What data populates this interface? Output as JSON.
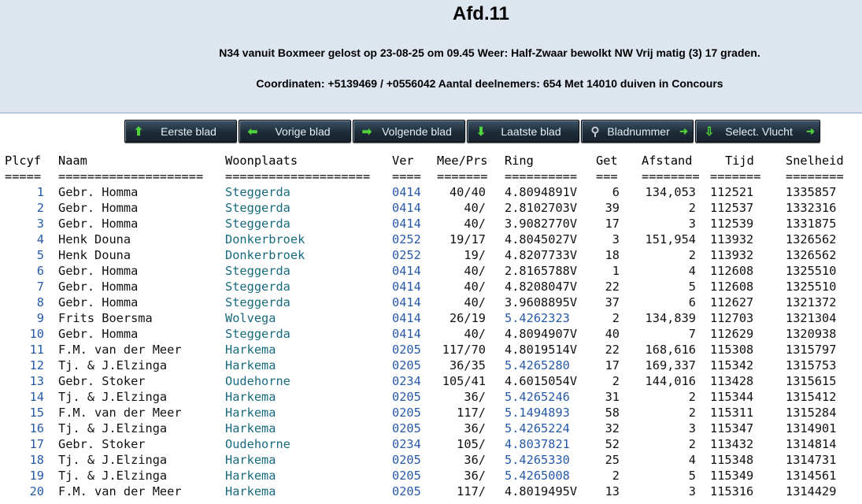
{
  "header": {
    "title": "Afd.11",
    "line1": "N34 vanuit Boxmeer gelost op 23-08-25 om 09.45 Weer: Half-Zwaar bewolkt NW Vrij matig (3) 17 graden.",
    "line2": "Coordinaten: +5139469 / +0556042 Aantal deelnemers: 654 Met 14010 duiven in Concours"
  },
  "nav": {
    "first": "Eerste blad",
    "prev": "Vorige blad",
    "next": "Volgende blad",
    "last": "Laatste blad",
    "page": "Bladnummer",
    "select": "Select. Vlucht"
  },
  "columns": {
    "pl": "Plcyf",
    "naam": "Naam",
    "woon": "Woonplaats",
    "ver": "Ver",
    "mee": "Mee/Prs",
    "ring": "Ring",
    "get": "Get",
    "afs": "Afstand",
    "tijd": "Tijd",
    "snel": "Snelheid"
  },
  "separators": {
    "pl": "=====",
    "naam": "====================",
    "woon": "====================",
    "ver": "====",
    "mee": "=======",
    "ring": "==========",
    "get": "===",
    "afs": "========",
    "tijd": "=======",
    "snel": "========"
  },
  "rows": [
    {
      "pl": "1",
      "naam": "Gebr. Homma",
      "woon": "Steggerda",
      "ver": "0414",
      "mee": "40/40",
      "ring": "4.8094891V",
      "get": "6",
      "afs": "134,053",
      "tijd": "112521",
      "snel": "1335857"
    },
    {
      "pl": "2",
      "naam": "Gebr. Homma",
      "woon": "Steggerda",
      "ver": "0414",
      "mee": "40/",
      "ring": "2.8102703V",
      "get": "39",
      "afs": "2",
      "tijd": "112537",
      "snel": "1332316"
    },
    {
      "pl": "3",
      "naam": "Gebr. Homma",
      "woon": "Steggerda",
      "ver": "0414",
      "mee": "40/",
      "ring": "3.9082770V",
      "get": "17",
      "afs": "3",
      "tijd": "112539",
      "snel": "1331875"
    },
    {
      "pl": "4",
      "naam": "Henk Douna",
      "woon": "Donkerbroek",
      "ver": "0252",
      "mee": "19/17",
      "ring": "4.8045027V",
      "get": "3",
      "afs": "151,954",
      "tijd": "113932",
      "snel": "1326562"
    },
    {
      "pl": "5",
      "naam": "Henk Douna",
      "woon": "Donkerbroek",
      "ver": "0252",
      "mee": "19/",
      "ring": "4.8207733V",
      "get": "18",
      "afs": "2",
      "tijd": "113932",
      "snel": "1326562"
    },
    {
      "pl": "6",
      "naam": "Gebr. Homma",
      "woon": "Steggerda",
      "ver": "0414",
      "mee": "40/",
      "ring": "2.8165788V",
      "get": "1",
      "afs": "4",
      "tijd": "112608",
      "snel": "1325510"
    },
    {
      "pl": "7",
      "naam": "Gebr. Homma",
      "woon": "Steggerda",
      "ver": "0414",
      "mee": "40/",
      "ring": "4.8208047V",
      "get": "22",
      "afs": "5",
      "tijd": "112608",
      "snel": "1325510"
    },
    {
      "pl": "8",
      "naam": "Gebr. Homma",
      "woon": "Steggerda",
      "ver": "0414",
      "mee": "40/",
      "ring": "3.9608895V",
      "get": "37",
      "afs": "6",
      "tijd": "112627",
      "snel": "1321372"
    },
    {
      "pl": "9",
      "naam": "Frits Boersma",
      "woon": "Wolvega",
      "ver": "0414",
      "mee": "26/19",
      "ring": "5.4262323",
      "get": "2",
      "afs": "134,839",
      "tijd": "112703",
      "snel": "1321304"
    },
    {
      "pl": "10",
      "naam": "Gebr. Homma",
      "woon": "Steggerda",
      "ver": "0414",
      "mee": "40/",
      "ring": "4.8094907V",
      "get": "40",
      "afs": "7",
      "tijd": "112629",
      "snel": "1320938"
    },
    {
      "pl": "11",
      "naam": "F.M. van der Meer",
      "woon": "Harkema",
      "ver": "0205",
      "mee": "117/70",
      "ring": "4.8019514V",
      "get": "22",
      "afs": "168,616",
      "tijd": "115308",
      "snel": "1315797"
    },
    {
      "pl": "12",
      "naam": "Tj. & J.Elzinga",
      "woon": "Harkema",
      "ver": "0205",
      "mee": "36/35",
      "ring": "5.4265280",
      "get": "17",
      "afs": "169,337",
      "tijd": "115342",
      "snel": "1315753"
    },
    {
      "pl": "13",
      "naam": "Gebr. Stoker",
      "woon": "Oudehorne",
      "ver": "0234",
      "mee": "105/41",
      "ring": "4.6015054V",
      "get": "2",
      "afs": "144,016",
      "tijd": "113428",
      "snel": "1315615"
    },
    {
      "pl": "14",
      "naam": "Tj. & J.Elzinga",
      "woon": "Harkema",
      "ver": "0205",
      "mee": "36/",
      "ring": "5.4265246",
      "get": "31",
      "afs": "2",
      "tijd": "115344",
      "snel": "1315412"
    },
    {
      "pl": "15",
      "naam": "F.M. van der Meer",
      "woon": "Harkema",
      "ver": "0205",
      "mee": "117/",
      "ring": "5.1494893",
      "get": "58",
      "afs": "2",
      "tijd": "115311",
      "snel": "1315284"
    },
    {
      "pl": "16",
      "naam": "Tj. & J.Elzinga",
      "woon": "Harkema",
      "ver": "0205",
      "mee": "36/",
      "ring": "5.4265224",
      "get": "32",
      "afs": "3",
      "tijd": "115347",
      "snel": "1314901"
    },
    {
      "pl": "17",
      "naam": "Gebr. Stoker",
      "woon": "Oudehorne",
      "ver": "0234",
      "mee": "105/",
      "ring": "4.8037821",
      "get": "52",
      "afs": "2",
      "tijd": "113432",
      "snel": "1314814"
    },
    {
      "pl": "18",
      "naam": "Tj. & J.Elzinga",
      "woon": "Harkema",
      "ver": "0205",
      "mee": "36/",
      "ring": "5.4265330",
      "get": "25",
      "afs": "4",
      "tijd": "115348",
      "snel": "1314731"
    },
    {
      "pl": "19",
      "naam": "Tj. & J.Elzinga",
      "woon": "Harkema",
      "ver": "0205",
      "mee": "36/",
      "ring": "5.4265008",
      "get": "2",
      "afs": "5",
      "tijd": "115349",
      "snel": "1314561"
    },
    {
      "pl": "20",
      "naam": "F.M. van der Meer",
      "woon": "Harkema",
      "ver": "0205",
      "mee": "117/",
      "ring": "4.8019495V",
      "get": "13",
      "afs": "3",
      "tijd": "115316",
      "snel": "1314429"
    }
  ]
}
